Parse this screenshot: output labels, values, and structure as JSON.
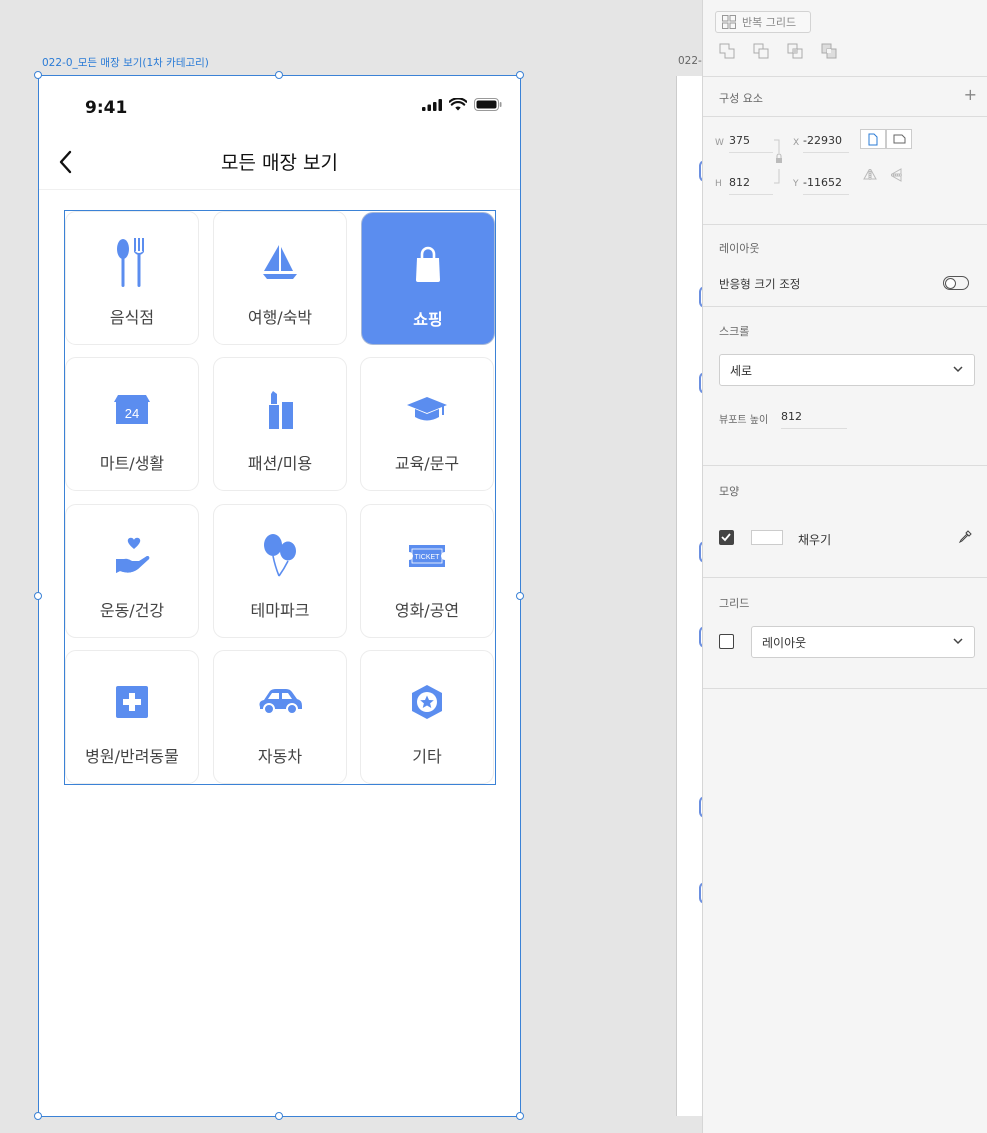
{
  "canvas": {
    "artboard_label": "022-0_모든 매장 보기(1차 카테고리)",
    "artboard2_label": "022-"
  },
  "phone": {
    "status_time": "9:41",
    "header_title": "모든 매장 보기",
    "categories": [
      {
        "label": "음식점",
        "icon": "utensils-icon",
        "active": false
      },
      {
        "label": "여행/숙박",
        "icon": "sailboat-icon",
        "active": false
      },
      {
        "label": "쇼핑",
        "icon": "shopping-bag-icon",
        "active": true
      },
      {
        "label": "마트/생활",
        "icon": "store-24-icon",
        "active": false
      },
      {
        "label": "패션/미용",
        "icon": "cosmetics-icon",
        "active": false
      },
      {
        "label": "교육/문구",
        "icon": "graduation-cap-icon",
        "active": false
      },
      {
        "label": "운동/건강",
        "icon": "heart-hand-icon",
        "active": false
      },
      {
        "label": "테마파크",
        "icon": "balloons-icon",
        "active": false
      },
      {
        "label": "영화/공연",
        "icon": "ticket-icon",
        "active": false
      },
      {
        "label": "병원/반려동물",
        "icon": "medical-cross-icon",
        "active": false
      },
      {
        "label": "자동차",
        "icon": "car-icon",
        "active": false
      },
      {
        "label": "기타",
        "icon": "badge-star-icon",
        "active": false
      }
    ],
    "store_24_text": "24",
    "ticket_text": "TICKET",
    "accent_color": "#5b8def"
  },
  "panel": {
    "repeat_grid_label": "반복 그리드",
    "components_title": "구성 요소",
    "w_label": "W",
    "w_value": "375",
    "h_label": "H",
    "h_value": "812",
    "x_label": "X",
    "x_value": "-22930",
    "y_label": "Y",
    "y_value": "-11652",
    "layout_title": "레이아웃",
    "responsive_label": "반응형 크기 조정",
    "responsive_on": false,
    "scroll_title": "스크롤",
    "scroll_value": "세로",
    "viewport_label": "뷰포트 높이",
    "viewport_value": "812",
    "appearance_title": "모양",
    "fill_label": "채우기",
    "fill_checked": true,
    "grid_title": "그리드",
    "grid_value": "레이아웃",
    "grid_checked": false
  }
}
